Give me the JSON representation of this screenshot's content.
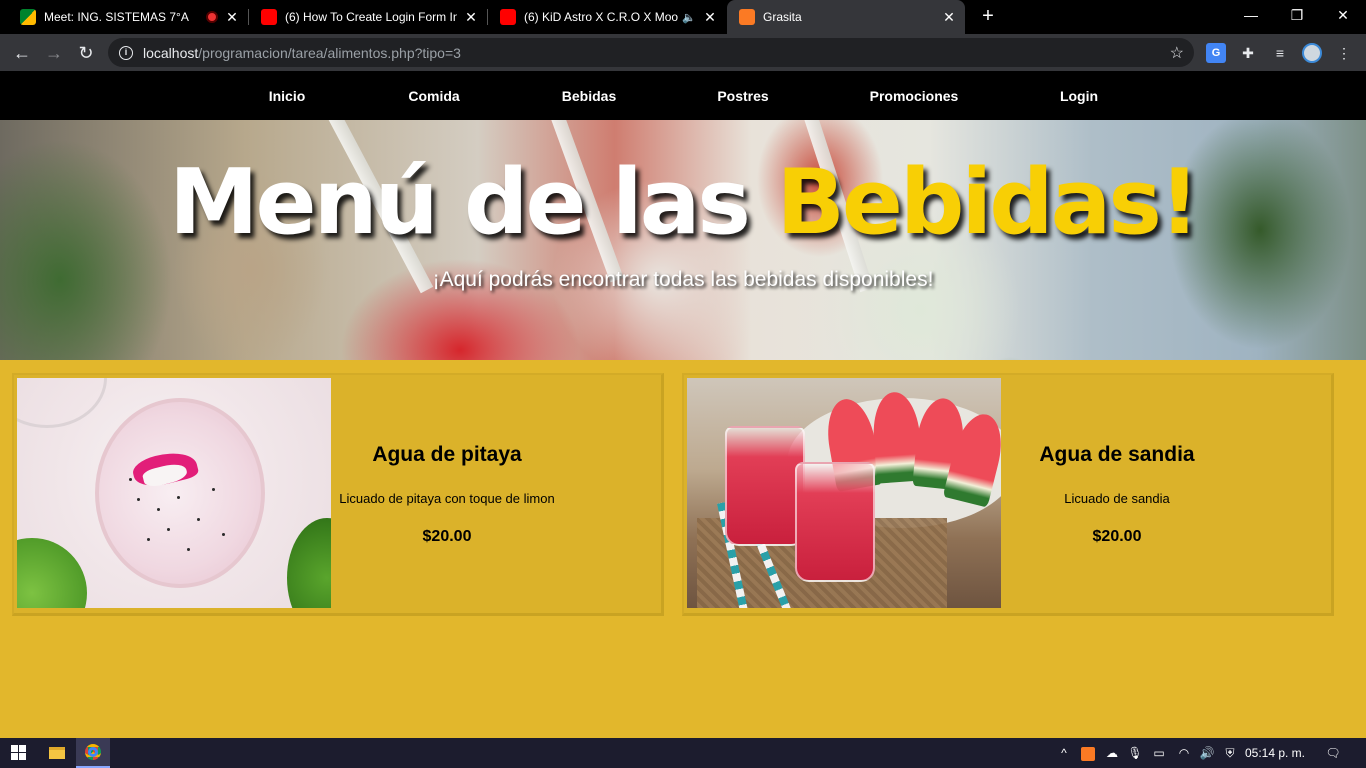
{
  "browser": {
    "tabs": [
      {
        "title": "Meet: ING. SISTEMAS 7°A",
        "favicon": "google-meet-icon",
        "recording": true
      },
      {
        "title": "(6) How To Create Login Form In",
        "favicon": "youtube-icon"
      },
      {
        "title": "(6) KiD Astro X C.R.O X Moon",
        "favicon": "youtube-icon",
        "audio": true
      },
      {
        "title": "Grasita",
        "favicon": "xampp-icon",
        "active": true
      }
    ],
    "close_glyph": "✕",
    "new_tab_glyph": "+",
    "window_controls": {
      "minimize": "—",
      "restore": "❐",
      "close": "✕"
    },
    "address": {
      "host": "localhost",
      "path": "/programacion/tarea/alimentos.php?tipo=3"
    }
  },
  "site": {
    "nav": [
      "Inicio",
      "Comida",
      "Bebidas",
      "Postres",
      "Promociones",
      "Login"
    ],
    "hero": {
      "title_main": "Menú de las ",
      "title_accent": "Bebidas!",
      "subtitle": "¡Aquí podrás encontrar todas las bebidas disponibles!"
    },
    "products": [
      {
        "name": "Agua de pitaya",
        "description": "Licuado de pitaya con toque de limon",
        "price": "$20.00"
      },
      {
        "name": "Agua de sandia",
        "description": "Licuado de sandia",
        "price": "$20.00"
      }
    ]
  },
  "taskbar": {
    "clock": "05:14 p. m."
  },
  "colors": {
    "page_background": "#e2b72c",
    "card_background": "#dbb22a",
    "accent_yellow": "#f8cf05",
    "nav_background": "#000000"
  }
}
